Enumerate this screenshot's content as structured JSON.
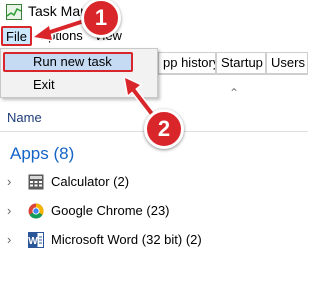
{
  "window": {
    "title": "Task Manager",
    "title_visible": "Task Mana"
  },
  "menu": {
    "file": "File",
    "options": "Options",
    "view": "View"
  },
  "file_menu": {
    "run_new_task": "Run new task",
    "exit": "Exit"
  },
  "tabs": [
    {
      "label": "pp history"
    },
    {
      "label": "Startup"
    },
    {
      "label": "Users"
    }
  ],
  "columns": {
    "name": "Name"
  },
  "group": {
    "title": "Apps (8)",
    "items": [
      {
        "label": "Calculator (2)",
        "icon": "calculator-icon"
      },
      {
        "label": "Google Chrome (23)",
        "icon": "chrome-icon"
      },
      {
        "label": "Microsoft Word (32 bit) (2)",
        "icon": "word-icon"
      }
    ]
  },
  "callouts": {
    "one": "1",
    "two": "2"
  },
  "colors": {
    "highlight_red": "#d9262a",
    "group_blue": "#1464c8",
    "menu_highlight": "#c5dbf3"
  }
}
